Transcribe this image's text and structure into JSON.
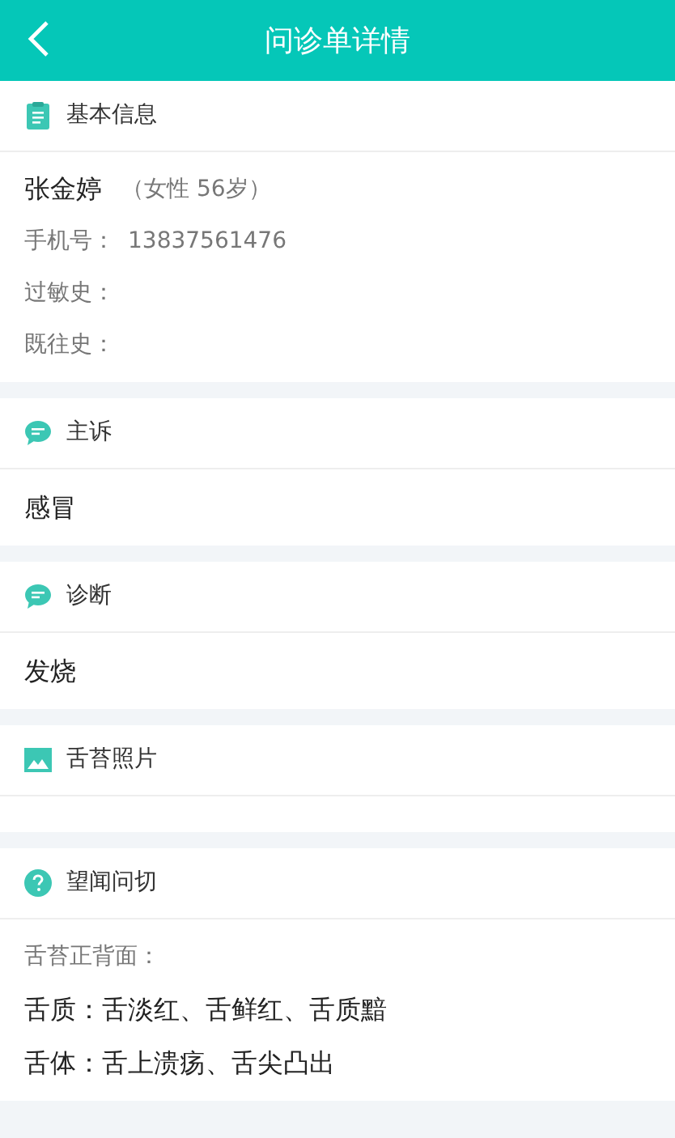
{
  "header": {
    "title": "问诊单详情"
  },
  "sections": [
    {
      "kind": "clipboard",
      "title": "基本信息",
      "lines": [
        {
          "kind": "name",
          "text": "张金婷",
          "detail": "（女性 56岁）"
        },
        {
          "kind": "field",
          "label": "手机号：",
          "value": "13837561476"
        },
        {
          "kind": "field",
          "label": "过敏史："
        },
        {
          "kind": "field",
          "label": "既往史："
        }
      ]
    },
    {
      "kind": "chat",
      "title": "主诉",
      "lines": [
        {
          "kind": "text",
          "text": "感冒"
        }
      ]
    },
    {
      "kind": "chat",
      "title": "诊断",
      "lines": [
        {
          "kind": "text",
          "text": "发烧"
        }
      ]
    },
    {
      "kind": "image",
      "title": "舌苔照片"
    },
    {
      "kind": "question",
      "title": "望闻问切",
      "lines": [
        {
          "kind": "field",
          "label": "舌苔正背面："
        },
        {
          "kind": "text",
          "text": "舌质：舌淡红、舌鲜红、舌质黯"
        },
        {
          "kind": "text",
          "text": "舌体：舌上溃疡、舌尖凸出"
        }
      ]
    }
  ]
}
